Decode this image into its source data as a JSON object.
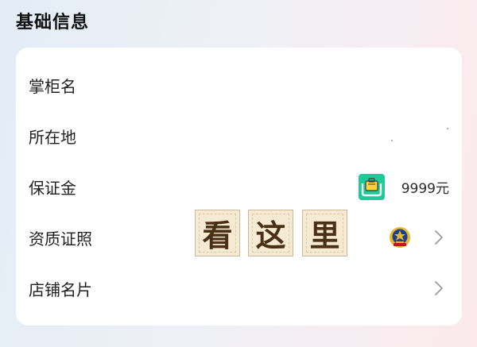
{
  "section": {
    "title": "基础信息"
  },
  "rows": [
    {
      "label": "掌柜名"
    },
    {
      "label": "所在地"
    },
    {
      "label": "保证金",
      "amount": "9999元",
      "icon": "deposit-icon"
    },
    {
      "label": "资质证照",
      "overlay": [
        "看",
        "这",
        "里"
      ],
      "icon": "police-emblem-icon"
    },
    {
      "label": "店铺名片"
    }
  ],
  "colors": {
    "deposit_icon_bg": "#1ec99a",
    "tile_bg": "#f7ead4",
    "tile_text": "#4a3016",
    "emblem_red": "#c8102e",
    "emblem_gold": "#e4b92b"
  }
}
